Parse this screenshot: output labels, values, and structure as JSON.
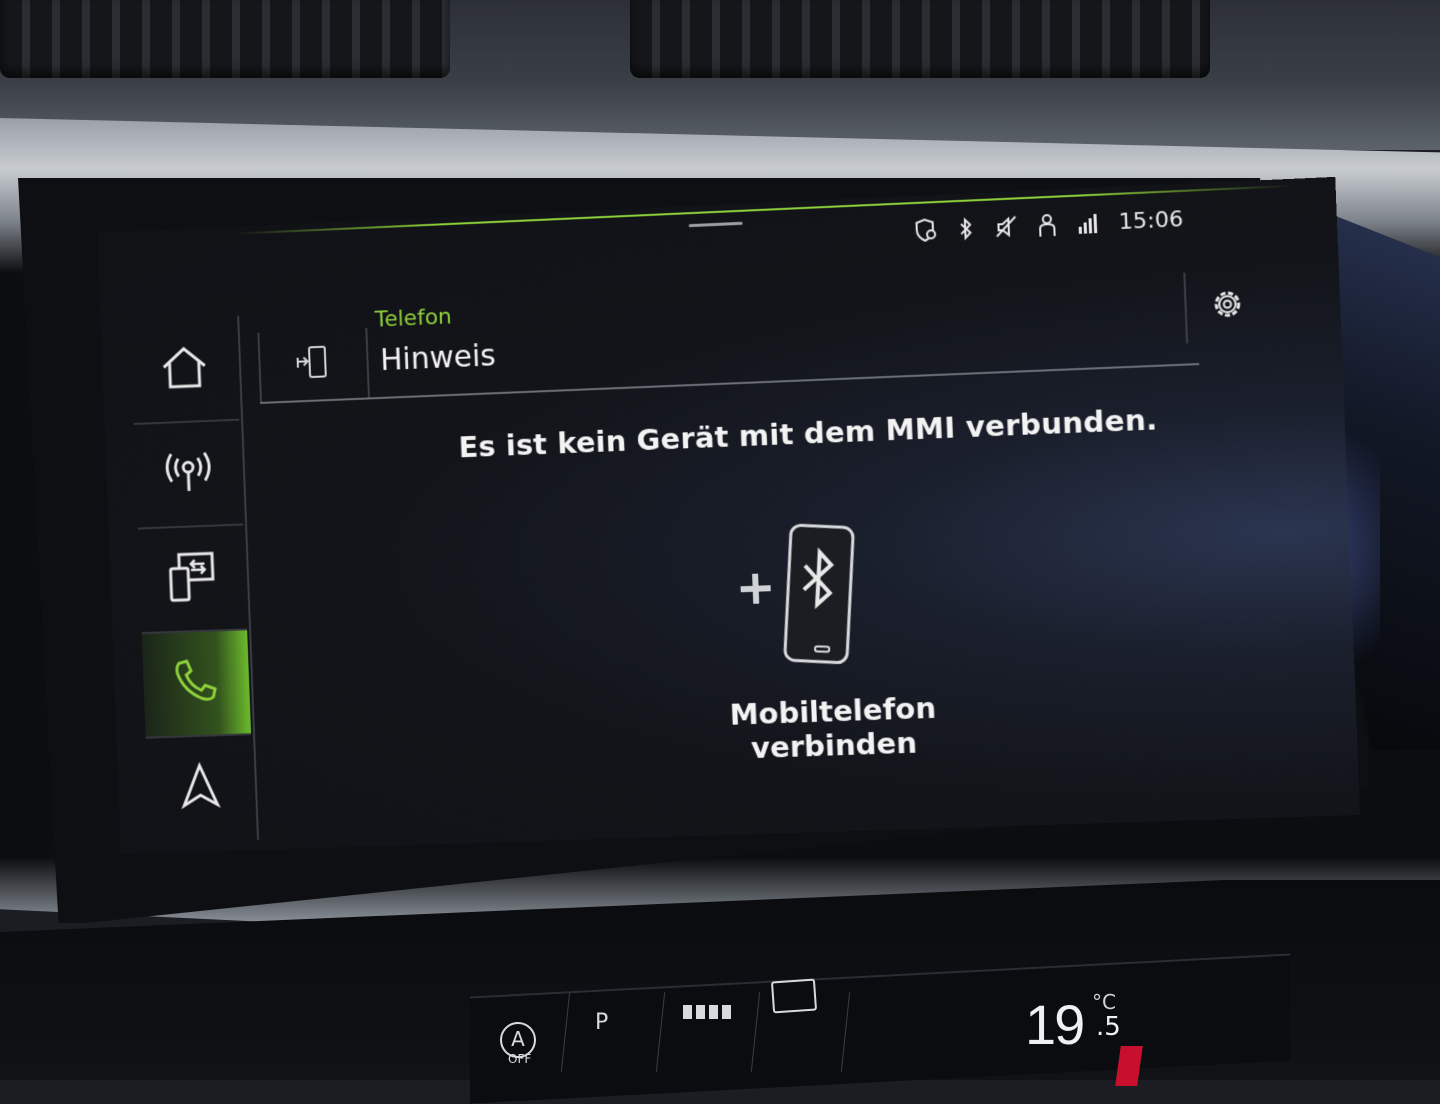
{
  "status_bar": {
    "time": "15:06",
    "icons": [
      "location-shield-icon",
      "bluetooth-icon",
      "mute-icon",
      "person-icon",
      "lte-icon"
    ]
  },
  "sidebar": {
    "items": [
      {
        "name": "home",
        "icon": "home-icon",
        "active": false
      },
      {
        "name": "radio",
        "icon": "radio-icon",
        "active": false
      },
      {
        "name": "media",
        "icon": "media-icon",
        "active": false
      },
      {
        "name": "phone",
        "icon": "phone-icon",
        "active": true
      },
      {
        "name": "navigation",
        "icon": "navigation-icon",
        "active": false
      }
    ]
  },
  "header": {
    "category": "Telefon",
    "title": "Hinweis"
  },
  "main": {
    "message": "Es ist kein Gerät mit dem MMI verbunden.",
    "connect_label": "Mobiltelefon verbinden"
  },
  "climate": {
    "auto_label": "A",
    "auto_off": "OFF",
    "p_label": "P",
    "temperature": "19",
    "temperature_decimal": ".5",
    "unit": "°C"
  },
  "colors": {
    "accent": "#8fd13a",
    "text": "#f3f3f3",
    "background": "#121419"
  }
}
